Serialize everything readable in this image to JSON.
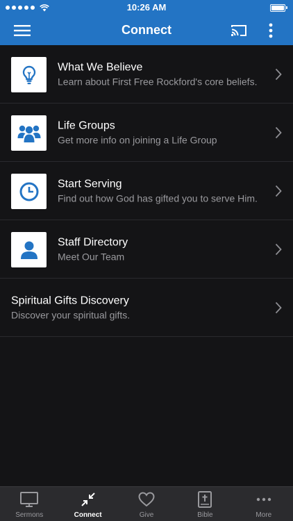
{
  "status_bar": {
    "time": "10:26 AM"
  },
  "header": {
    "title": "Connect"
  },
  "items": [
    {
      "title": "What We Believe",
      "subtitle": "Learn about First Free Rockford's core beliefs.",
      "icon": "lightbulb-icon"
    },
    {
      "title": "Life Groups",
      "subtitle": "Get more info on joining a Life Group",
      "icon": "group-icon"
    },
    {
      "title": "Start Serving",
      "subtitle": "Find out how God has gifted you to serve Him.",
      "icon": "clock-icon"
    },
    {
      "title": "Staff Directory",
      "subtitle": "Meet Our Team",
      "icon": "person-icon"
    },
    {
      "title": "Spiritual Gifts Discovery",
      "subtitle": "Discover your spiritual gifts.",
      "icon": ""
    }
  ],
  "tabs": [
    {
      "label": "Sermons",
      "icon": "tv-icon",
      "active": false
    },
    {
      "label": "Connect",
      "icon": "connect-arrows-icon",
      "active": true
    },
    {
      "label": "Give",
      "icon": "heart-icon",
      "active": false
    },
    {
      "label": "Bible",
      "icon": "bible-icon",
      "active": false
    },
    {
      "label": "More",
      "icon": "more-dots-icon",
      "active": false
    }
  ],
  "colors": {
    "accent": "#2374c4",
    "background": "#141416",
    "tab_bar": "#2b2b2e",
    "subtitle": "#9a9a9e"
  }
}
